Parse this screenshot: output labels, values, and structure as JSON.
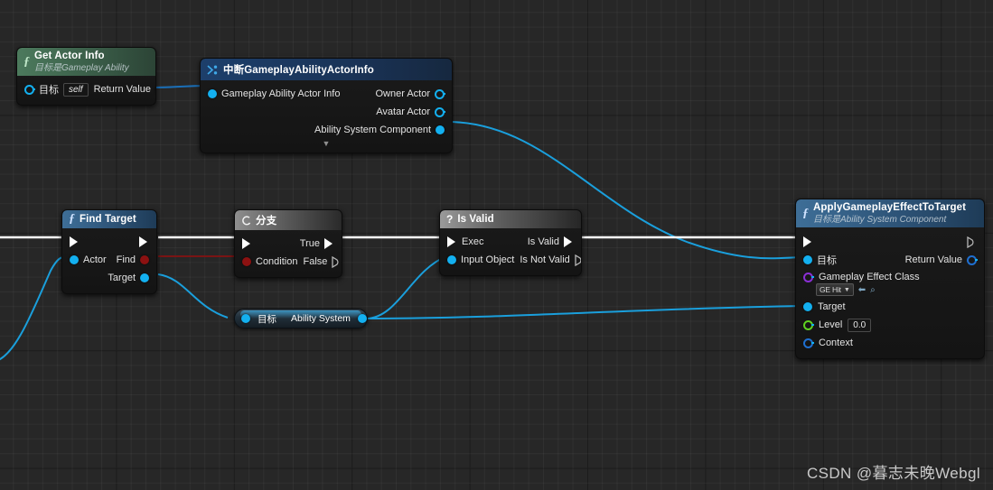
{
  "app": {
    "watermark": "CSDN @暮志未晚Webgl"
  },
  "nodes": {
    "get_actor_info": {
      "title": "Get Actor Info",
      "subtitle": "目标是Gameplay Ability",
      "icon": "function-icon",
      "header_color": "#44705a",
      "inputs": [
        {
          "label": "目标",
          "value": "self",
          "pin": "object-ref-pin"
        }
      ],
      "outputs": [
        {
          "label": "Return Value",
          "pin": "struct-pin"
        }
      ]
    },
    "break_actor_info": {
      "title": "中断GameplayAbilityActorInfo",
      "icon": "break-struct-icon",
      "header_color": "#1d3f6b",
      "inputs": [
        {
          "label": "Gameplay Ability Actor Info",
          "pin": "struct-pin"
        }
      ],
      "outputs": [
        {
          "label": "Owner Actor",
          "pin": "object-ref-pin"
        },
        {
          "label": "Avatar Actor",
          "pin": "object-ref-pin"
        },
        {
          "label": "Ability System Component",
          "pin": "object-pin"
        }
      ],
      "expander": "▼"
    },
    "find_target": {
      "title": "Find Target",
      "icon": "function-icon",
      "header_color": "#2f5d86",
      "inputs": [
        {
          "label": "",
          "pin": "exec-pin"
        },
        {
          "label": "Actor",
          "pin": "object-pin"
        }
      ],
      "outputs": [
        {
          "label": "",
          "pin": "exec-pin"
        },
        {
          "label": "Find",
          "pin": "bool-pin"
        },
        {
          "label": "Target",
          "pin": "object-pin"
        }
      ]
    },
    "branch": {
      "title": "分支",
      "icon": "branch-icon",
      "header_color": "#8e8e8e",
      "inputs": [
        {
          "label": "",
          "pin": "exec-pin"
        },
        {
          "label": "Condition",
          "pin": "bool-pin"
        }
      ],
      "outputs": [
        {
          "label": "True",
          "pin": "exec-pin"
        },
        {
          "label": "False",
          "pin": "exec-pin-hollow"
        }
      ]
    },
    "is_valid": {
      "title": "Is Valid",
      "icon": "question-icon",
      "header_color": "#9a9a9a",
      "inputs": [
        {
          "label": "Exec",
          "pin": "exec-pin"
        },
        {
          "label": "Input Object",
          "pin": "object-pin"
        }
      ],
      "outputs": [
        {
          "label": "Is Valid",
          "pin": "exec-pin"
        },
        {
          "label": "Is Not Valid",
          "pin": "exec-pin-hollow"
        }
      ]
    },
    "apply_effect": {
      "title": "ApplyGameplayEffectToTarget",
      "subtitle": "目标是Ability System Component",
      "icon": "function-icon",
      "header_color": "#3e6e97",
      "inputs": [
        {
          "label": "",
          "pin": "exec-pin"
        },
        {
          "label": "目标",
          "pin": "object-pin"
        },
        {
          "label": "Gameplay Effect Class",
          "pin": "class-pin",
          "asset": "GE Hit"
        },
        {
          "label": "Target",
          "pin": "object-pin"
        },
        {
          "label": "Level",
          "pin": "float-pin",
          "value": "0.0"
        },
        {
          "label": "Context",
          "pin": "struct-pin"
        }
      ],
      "outputs": [
        {
          "label": "",
          "pin": "exec-pin-hollow"
        },
        {
          "label": "Return Value",
          "pin": "object-ref-pin"
        }
      ]
    },
    "reroute_ability_system": {
      "left_label": "目标",
      "right_label": "Ability System",
      "pin": "object-pin"
    }
  },
  "colors": {
    "exec_wire": "#ffffff",
    "object_wire": "#1a9fdc",
    "bool_wire": "#8c1111",
    "canvas_bg": "#272727"
  }
}
